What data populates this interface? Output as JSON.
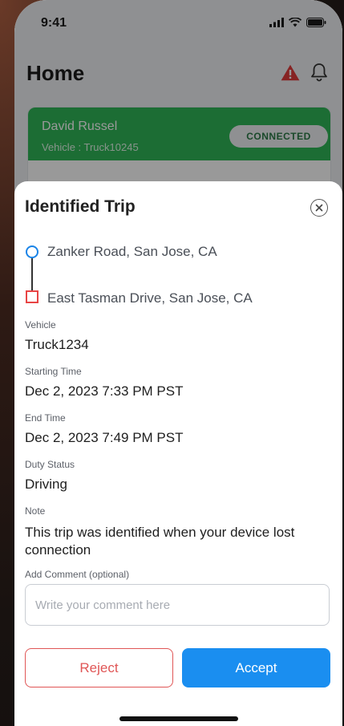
{
  "status_bar": {
    "time": "9:41"
  },
  "home": {
    "title": "Home",
    "driver_card": {
      "name": "David Russel",
      "vehicle": "Vehicle : Truck10245",
      "status": "CONNECTED",
      "status_color": "#2fb657"
    }
  },
  "trip_sheet": {
    "title": "Identified Trip",
    "origin": "Zanker Road, San Jose, CA",
    "destination": "East Tasman Drive, San Jose, CA",
    "vehicle_label": "Vehicle",
    "vehicle_value": "Truck1234",
    "start_label": "Starting Time",
    "start_value": "Dec 2, 2023 7:33 PM PST",
    "end_label": "End Time",
    "end_value": "Dec 2, 2023 7:49 PM PST",
    "duty_label": "Duty Status",
    "duty_value": "Driving",
    "note_label": "Note",
    "note_value": "This trip was identified when your device lost connection",
    "comment_label": "Add Comment (optional)",
    "comment_placeholder": "Write your comment here",
    "comment_value": "",
    "reject_label": "Reject",
    "accept_label": "Accept"
  },
  "icons": {
    "alert": "warning-triangle-icon",
    "notifications": "bell-icon",
    "close": "close-circle-icon",
    "origin": "origin-circle-icon",
    "destination": "destination-square-icon"
  },
  "colors": {
    "accent": "#1a8ef0",
    "reject": "#e05656",
    "alert": "#e03b3b",
    "origin_marker": "#1a84e8",
    "destination_marker": "#e84545"
  }
}
